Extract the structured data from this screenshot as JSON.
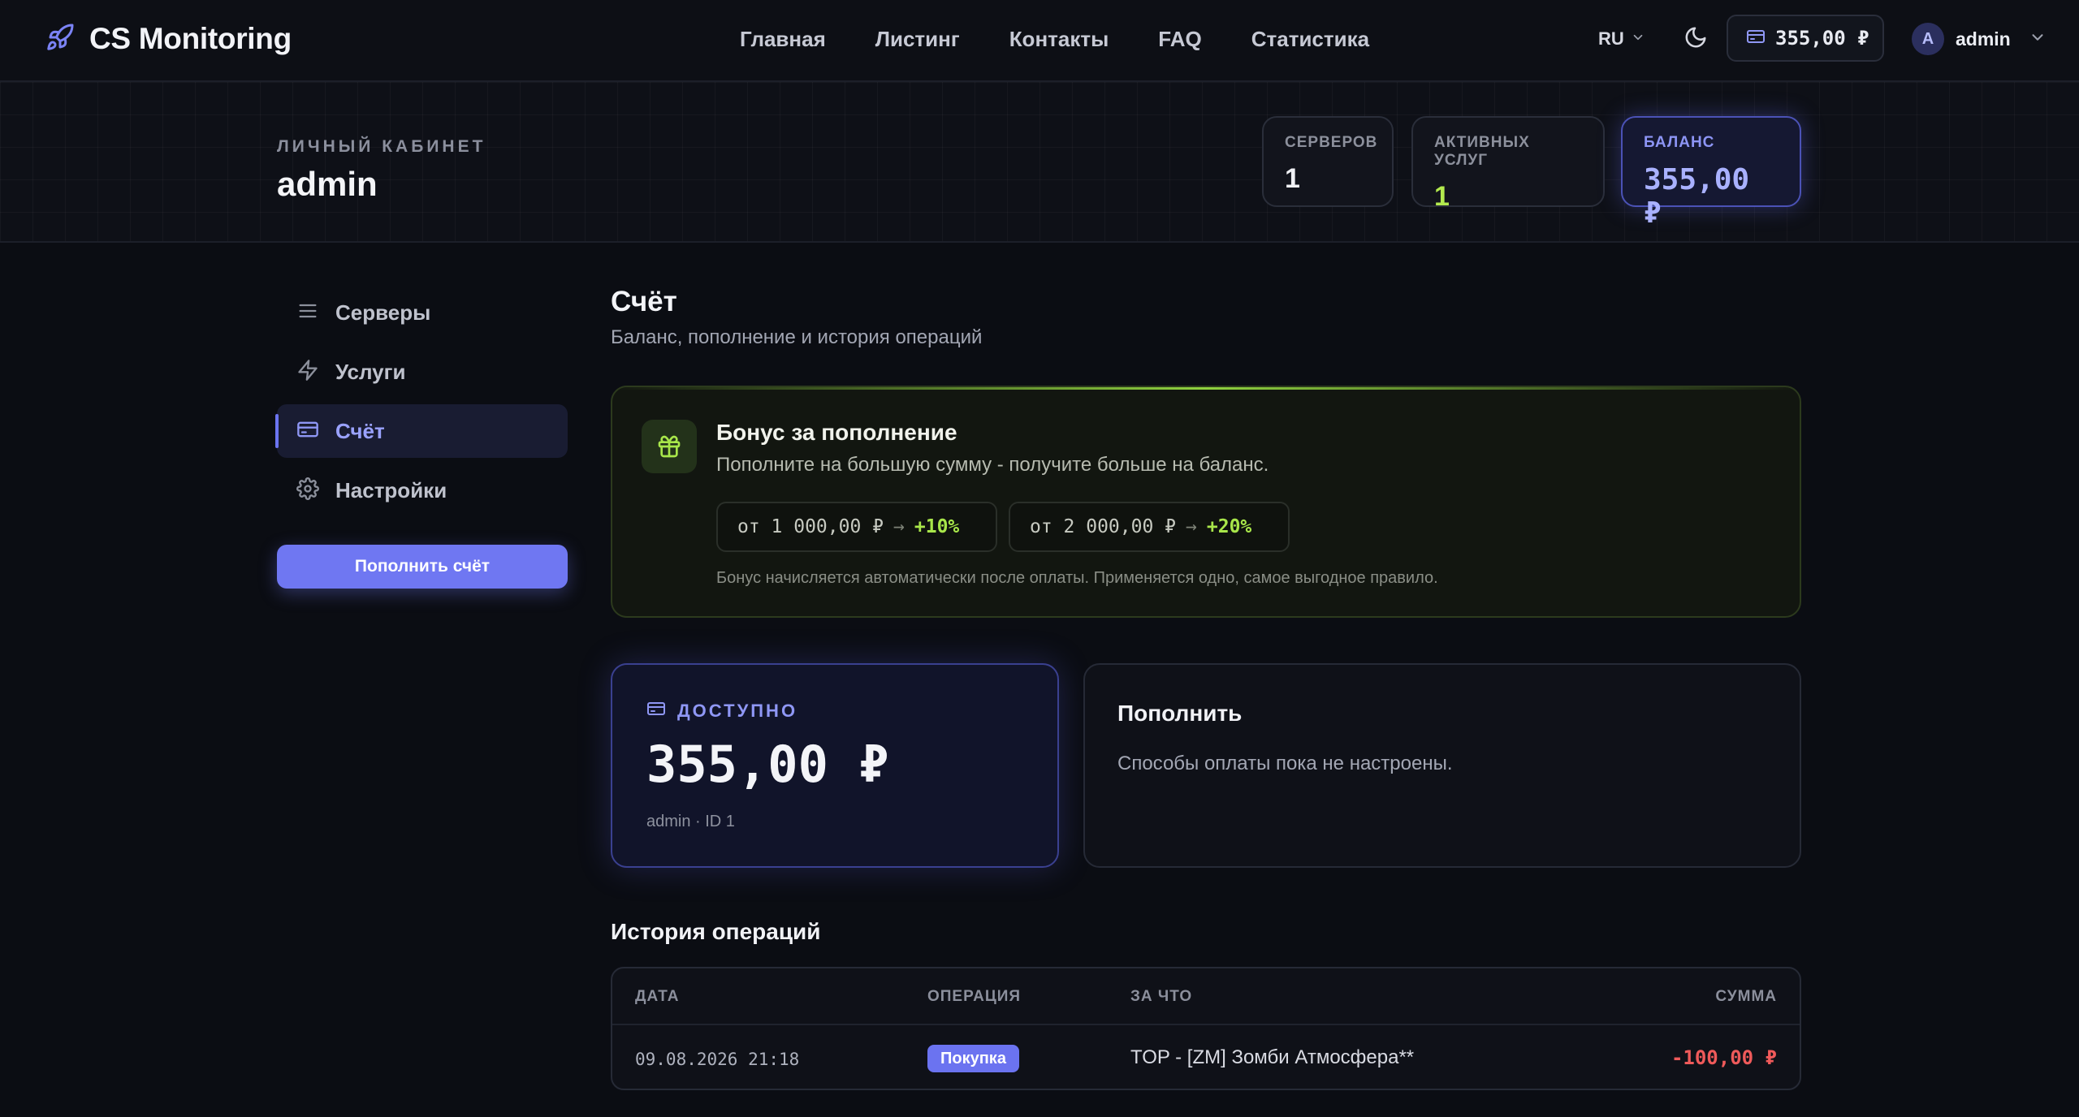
{
  "brand": {
    "name": "CS Monitoring"
  },
  "nav": [
    {
      "label": "Главная"
    },
    {
      "label": "Листинг"
    },
    {
      "label": "Контакты"
    },
    {
      "label": "FAQ"
    },
    {
      "label": "Статистика"
    }
  ],
  "header": {
    "language": "RU",
    "balance": "355,00 ₽",
    "user_initial": "A",
    "user_name": "admin"
  },
  "hero": {
    "kicker": "ЛИЧНЫЙ КАБИНЕТ",
    "name": "admin",
    "stats": {
      "servers_label": "СЕРВЕРОВ",
      "servers_value": "1",
      "services_label": "АКТИВНЫХ УСЛУГ",
      "services_value": "1",
      "balance_label": "БАЛАНС",
      "balance_value": "355,00 ₽"
    }
  },
  "sidebar": {
    "items": [
      {
        "label": "Серверы",
        "icon": "list-icon"
      },
      {
        "label": "Услуги",
        "icon": "lightning-icon"
      },
      {
        "label": "Счёт",
        "icon": "card-icon",
        "active": true
      },
      {
        "label": "Настройки",
        "icon": "gear-icon"
      }
    ],
    "topup_label": "Пополнить счёт"
  },
  "main": {
    "title": "Счёт",
    "subtitle": "Баланс, пополнение и история операций",
    "bonus": {
      "title": "Бонус за пополнение",
      "description": "Пополните на большую сумму - получите больше на баланс.",
      "tiers": [
        {
          "from": "от 1 000,00 ₽",
          "arrow": "→",
          "bonus": "+10%"
        },
        {
          "from": "от 2 000,00 ₽",
          "arrow": "→",
          "bonus": "+20%"
        }
      ],
      "note": "Бонус начисляется автоматически после оплаты. Применяется одно, самое выгодное правило."
    },
    "available": {
      "label": "ДОСТУПНО",
      "amount": "355,00 ₽",
      "meta": "admin · ID 1"
    },
    "refill": {
      "title": "Пополнить",
      "text": "Способы оплаты пока не настроены."
    },
    "history": {
      "title": "История операций",
      "columns": [
        "ДАТА",
        "ОПЕРАЦИЯ",
        "ЗА ЧТО",
        "СУММА"
      ],
      "rows": [
        {
          "date": "09.08.2026 21:18",
          "operation": "Покупка",
          "for": "TOP - [ZM] Зомби Атмосфера**",
          "amount": "-100,00 ₽"
        }
      ]
    }
  },
  "colors": {
    "accent": "#6f77f2",
    "bonus_green": "#a8e64a",
    "negative": "#ef5a5a",
    "background": "#0b0d13"
  }
}
